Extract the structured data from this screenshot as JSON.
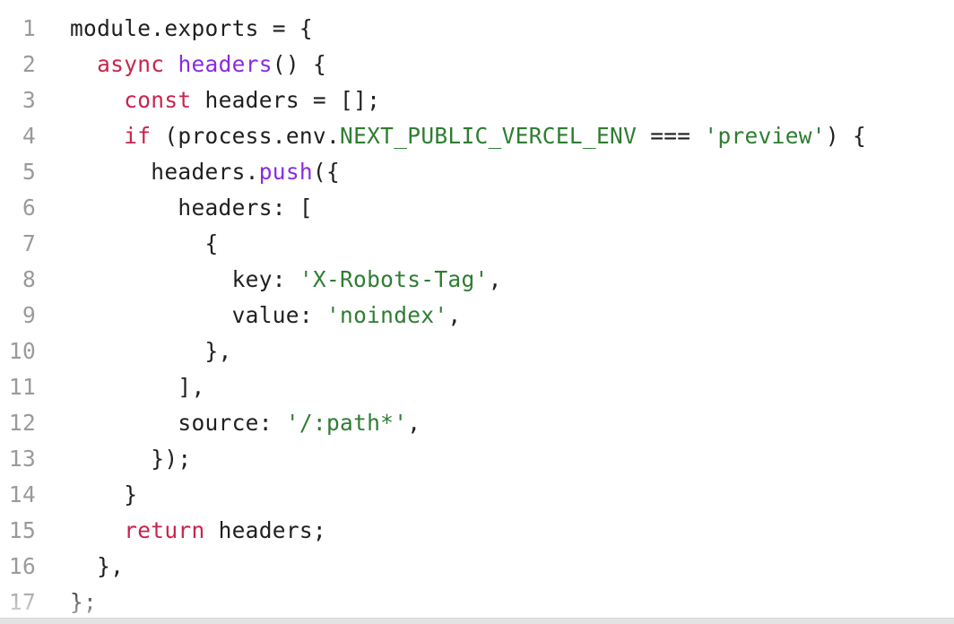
{
  "editor": {
    "lines": [
      {
        "n": "1",
        "tokens": [
          {
            "t": "module.exports = {",
            "c": ""
          }
        ]
      },
      {
        "n": "2",
        "tokens": [
          {
            "t": "  ",
            "c": ""
          },
          {
            "t": "async",
            "c": "kw"
          },
          {
            "t": " ",
            "c": ""
          },
          {
            "t": "headers",
            "c": "fn"
          },
          {
            "t": "() {",
            "c": ""
          }
        ]
      },
      {
        "n": "3",
        "tokens": [
          {
            "t": "    ",
            "c": ""
          },
          {
            "t": "const",
            "c": "kw"
          },
          {
            "t": " headers = [];",
            "c": ""
          }
        ]
      },
      {
        "n": "4",
        "tokens": [
          {
            "t": "    ",
            "c": ""
          },
          {
            "t": "if",
            "c": "kw"
          },
          {
            "t": " (process.env.",
            "c": ""
          },
          {
            "t": "NEXT_PUBLIC_VERCEL_ENV",
            "c": "cn"
          },
          {
            "t": " === ",
            "c": ""
          },
          {
            "t": "'preview'",
            "c": "str"
          },
          {
            "t": ") {",
            "c": ""
          }
        ]
      },
      {
        "n": "5",
        "tokens": [
          {
            "t": "      headers.",
            "c": ""
          },
          {
            "t": "push",
            "c": "fn"
          },
          {
            "t": "({",
            "c": ""
          }
        ]
      },
      {
        "n": "6",
        "tokens": [
          {
            "t": "        headers: [",
            "c": ""
          }
        ]
      },
      {
        "n": "7",
        "tokens": [
          {
            "t": "          {",
            "c": ""
          }
        ]
      },
      {
        "n": "8",
        "tokens": [
          {
            "t": "            key: ",
            "c": ""
          },
          {
            "t": "'X-Robots-Tag'",
            "c": "str"
          },
          {
            "t": ",",
            "c": ""
          }
        ]
      },
      {
        "n": "9",
        "tokens": [
          {
            "t": "            value: ",
            "c": ""
          },
          {
            "t": "'noindex'",
            "c": "str"
          },
          {
            "t": ",",
            "c": ""
          }
        ]
      },
      {
        "n": "10",
        "tokens": [
          {
            "t": "          },",
            "c": ""
          }
        ]
      },
      {
        "n": "11",
        "tokens": [
          {
            "t": "        ],",
            "c": ""
          }
        ]
      },
      {
        "n": "12",
        "tokens": [
          {
            "t": "        source: ",
            "c": ""
          },
          {
            "t": "'/:path*'",
            "c": "str"
          },
          {
            "t": ",",
            "c": ""
          }
        ]
      },
      {
        "n": "13",
        "tokens": [
          {
            "t": "      });",
            "c": ""
          }
        ]
      },
      {
        "n": "14",
        "tokens": [
          {
            "t": "    }",
            "c": ""
          }
        ]
      },
      {
        "n": "15",
        "tokens": [
          {
            "t": "    ",
            "c": ""
          },
          {
            "t": "return",
            "c": "kw"
          },
          {
            "t": " headers;",
            "c": ""
          }
        ]
      },
      {
        "n": "16",
        "tokens": [
          {
            "t": "  },",
            "c": ""
          }
        ]
      },
      {
        "n": "17",
        "tokens": [
          {
            "t": "};",
            "c": ""
          }
        ]
      }
    ]
  }
}
